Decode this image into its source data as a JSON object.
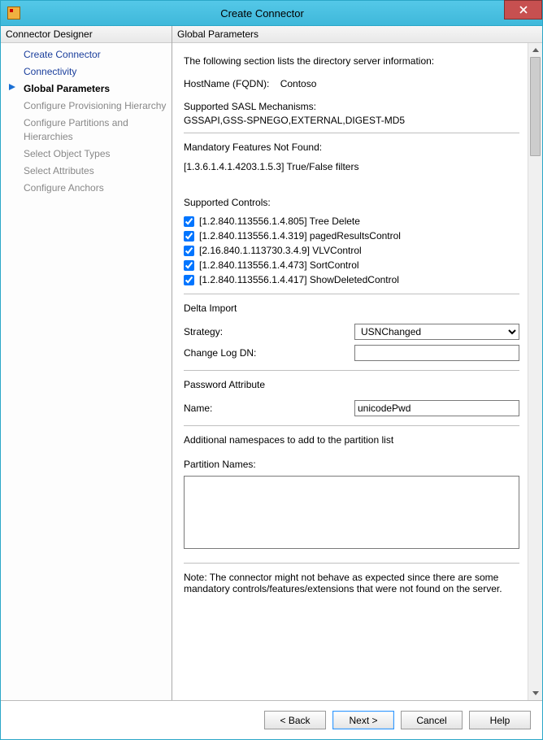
{
  "window": {
    "title": "Create Connector"
  },
  "sidebar": {
    "header": "Connector Designer",
    "items": [
      {
        "label": "Create Connector",
        "state": "link"
      },
      {
        "label": "Connectivity",
        "state": "link"
      },
      {
        "label": "Global Parameters",
        "state": "current"
      },
      {
        "label": "Configure Provisioning Hierarchy",
        "state": "disabled"
      },
      {
        "label": "Configure Partitions and Hierarchies",
        "state": "disabled"
      },
      {
        "label": "Select Object Types",
        "state": "disabled"
      },
      {
        "label": "Select Attributes",
        "state": "disabled"
      },
      {
        "label": "Configure Anchors",
        "state": "disabled"
      }
    ]
  },
  "main": {
    "header": "Global Parameters",
    "intro": "The following section lists the directory server information:",
    "host_label": "HostName (FQDN):",
    "host_value": "Contoso",
    "sasl_label": "Supported SASL Mechanisms:",
    "sasl_value": "GSSAPI,GSS-SPNEGO,EXTERNAL,DIGEST-MD5",
    "mandatory_label": "Mandatory Features Not Found:",
    "mandatory_value": "[1.3.6.1.4.1.4203.1.5.3] True/False filters",
    "controls_label": "Supported Controls:",
    "controls": [
      {
        "checked": true,
        "text": "[1.2.840.113556.1.4.805] Tree Delete"
      },
      {
        "checked": true,
        "text": "[1.2.840.113556.1.4.319] pagedResultsControl"
      },
      {
        "checked": true,
        "text": "[2.16.840.1.113730.3.4.9] VLVControl"
      },
      {
        "checked": true,
        "text": "[1.2.840.113556.1.4.473] SortControl"
      },
      {
        "checked": true,
        "text": "[1.2.840.113556.1.4.417] ShowDeletedControl"
      }
    ],
    "delta_header": "Delta Import",
    "strategy_label": "Strategy:",
    "strategy_value": "USNChanged",
    "changelog_label": "Change Log DN:",
    "changelog_value": "",
    "pwd_header": "Password Attribute",
    "pwd_name_label": "Name:",
    "pwd_name_value": "unicodePwd",
    "ns_intro": "Additional namespaces to add to the partition list",
    "partition_label": "Partition Names:",
    "partition_value": "",
    "note": "Note: The connector might not behave as expected since there are some mandatory controls/features/extensions that were not found on the server."
  },
  "buttons": {
    "back": "<  Back",
    "next": "Next  >",
    "cancel": "Cancel",
    "help": "Help"
  }
}
